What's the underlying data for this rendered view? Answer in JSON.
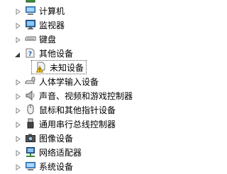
{
  "tree": {
    "items": [
      {
        "label": "计算机",
        "icon": "computer-icon",
        "expander": "collapsed"
      },
      {
        "label": "监视器",
        "icon": "monitor-icon",
        "expander": "collapsed"
      },
      {
        "label": "键盘",
        "icon": "keyboard-icon",
        "expander": "collapsed"
      },
      {
        "label": "其他设备",
        "icon": "unknown-device-icon",
        "expander": "expanded"
      },
      {
        "label": "未知设备",
        "icon": "warning-device-icon",
        "selected": true
      },
      {
        "label": "人体学输入设备",
        "icon": "hid-icon",
        "expander": "collapsed"
      },
      {
        "label": "声音、视频和游戏控制器",
        "icon": "speaker-icon",
        "expander": "collapsed"
      },
      {
        "label": "鼠标和其他指针设备",
        "icon": "mouse-icon",
        "expander": "collapsed"
      },
      {
        "label": "通用串行总线控制器",
        "icon": "usb-icon",
        "expander": "collapsed"
      },
      {
        "label": "图像设备",
        "icon": "camera-icon",
        "expander": "collapsed"
      },
      {
        "label": "网络适配器",
        "icon": "network-adapter-icon",
        "expander": "collapsed"
      },
      {
        "label": "系统设备",
        "icon": "system-device-icon",
        "expander": "collapsed"
      }
    ]
  }
}
